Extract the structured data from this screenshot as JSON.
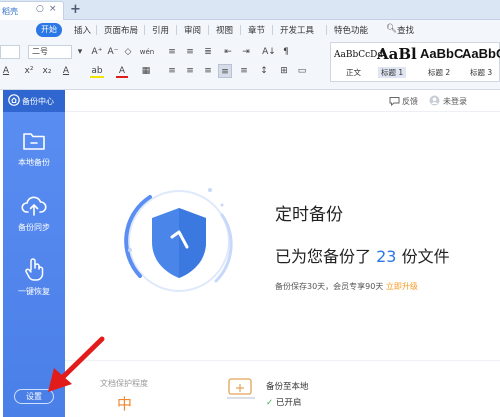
{
  "window": {
    "doc_tab": "稻壳",
    "tab_controls": [
      "○",
      "×"
    ],
    "new_tab": "+"
  },
  "menu": {
    "items": [
      "开始",
      "插入",
      "页面布局",
      "引用",
      "审阅",
      "视图",
      "章节",
      "开发工具",
      "特色功能"
    ],
    "search": "查找"
  },
  "toolbar": {
    "font_size": "二号",
    "format_row1": [
      "A⁺",
      "A⁻",
      "◇",
      "wén",
      "≡",
      "≡",
      "≣",
      "⇤",
      "⇥",
      "A↓",
      "¶"
    ],
    "format_row2": [
      "A",
      "x²",
      "x₂",
      "A",
      "ab",
      "A",
      "▦",
      "≡",
      "≡",
      "≡",
      "≡",
      "≡",
      "↕",
      "⊞",
      "▭"
    ]
  },
  "styles": [
    {
      "sample": "AaBbCcDd",
      "label": "正文"
    },
    {
      "sample": "AaBl",
      "label": "标题 1"
    },
    {
      "sample": "AaBbC",
      "label": "标题 2"
    },
    {
      "sample": "AaBbC",
      "label": "标题 3"
    }
  ],
  "sidebar": {
    "header": "备份中心",
    "items": [
      {
        "label": "本地备份",
        "icon": "folder-icon"
      },
      {
        "label": "备份同步",
        "icon": "cloud-upload-icon"
      },
      {
        "label": "一键恢复",
        "icon": "touch-icon"
      }
    ],
    "settings": "设置"
  },
  "topbar": {
    "feedback": "反馈",
    "login": "未登录"
  },
  "main": {
    "title": "定时备份",
    "backed_prefix": "已为您备份了",
    "backed_count": "23",
    "backed_suffix": "份文件",
    "info": "备份保存30天，会员专享90天",
    "upgrade": "立即升级"
  },
  "bottom": {
    "risk_label": "文档保护程度",
    "risk_value": "中",
    "backup_local": "备份至本地",
    "backup_status": "已开启"
  },
  "colors": {
    "accent": "#2b77e6",
    "sidebar": "#4a7fe8",
    "upgrade": "#f59b23",
    "risk": "#f0862e",
    "annotation_arrow": "#e21b1b"
  }
}
